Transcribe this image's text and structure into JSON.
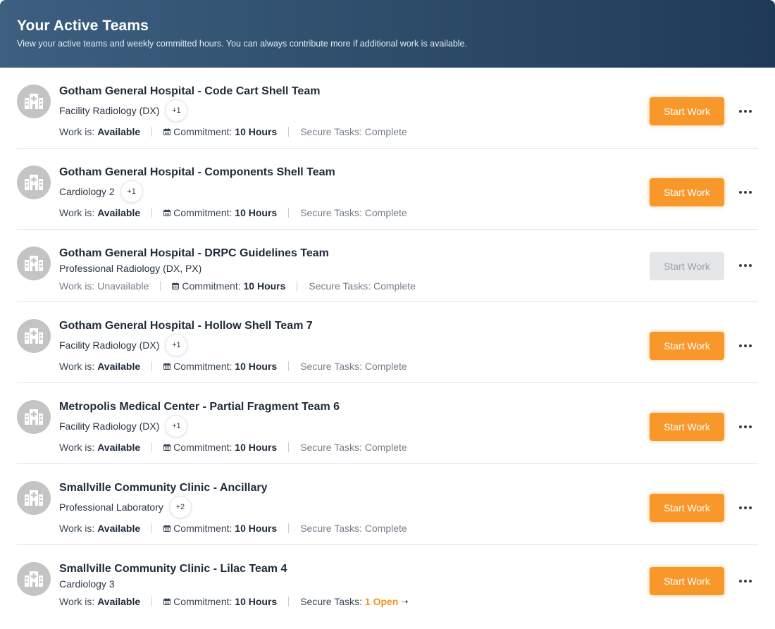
{
  "header": {
    "title": "Your Active Teams",
    "subtitle": "View your active teams and weekly committed hours. You can always contribute more if additional work is available."
  },
  "labels": {
    "work_is": "Work is:",
    "commitment": "Commitment:",
    "secure_tasks": "Secure Tasks:",
    "start_work": "Start Work"
  },
  "colors": {
    "accent": "#f8972a",
    "header_start": "#3d5f80",
    "header_end": "#1f3a57",
    "open_link": "#f39320"
  },
  "teams": [
    {
      "title": "Gotham General Hospital - Code Cart Shell Team",
      "specialty": "Facility Radiology (DX)",
      "badge": "+1",
      "work_status": "Available",
      "commitment": "10 Hours",
      "secure_tasks": "Complete",
      "button_enabled": true
    },
    {
      "title": "Gotham General Hospital - Components Shell Team",
      "specialty": "Cardiology 2",
      "badge": "+1",
      "work_status": "Available",
      "commitment": "10 Hours",
      "secure_tasks": "Complete",
      "button_enabled": true
    },
    {
      "title": "Gotham General Hospital - DRPC Guidelines Team",
      "specialty": "Professional Radiology (DX, PX)",
      "badge": "",
      "work_status": "Unavailable",
      "commitment": "10 Hours",
      "secure_tasks": "Complete",
      "button_enabled": false
    },
    {
      "title": "Gotham General Hospital - Hollow Shell Team 7",
      "specialty": "Facility Radiology (DX)",
      "badge": "+1",
      "work_status": "Available",
      "commitment": "10 Hours",
      "secure_tasks": "Complete",
      "button_enabled": true
    },
    {
      "title": "Metropolis Medical Center - Partial Fragment Team 6",
      "specialty": "Facility Radiology (DX)",
      "badge": "+1",
      "work_status": "Available",
      "commitment": "10 Hours",
      "secure_tasks": "Complete",
      "button_enabled": true
    },
    {
      "title": "Smallville Community Clinic - Ancillary",
      "specialty": "Professional Laboratory",
      "badge": "+2",
      "work_status": "Available",
      "commitment": "10 Hours",
      "secure_tasks": "Complete",
      "button_enabled": true
    },
    {
      "title": "Smallville Community Clinic - Lilac Team 4",
      "specialty": "Cardiology 3",
      "badge": "",
      "work_status": "Available",
      "commitment": "10 Hours",
      "secure_tasks": "1 Open",
      "button_enabled": true
    }
  ]
}
